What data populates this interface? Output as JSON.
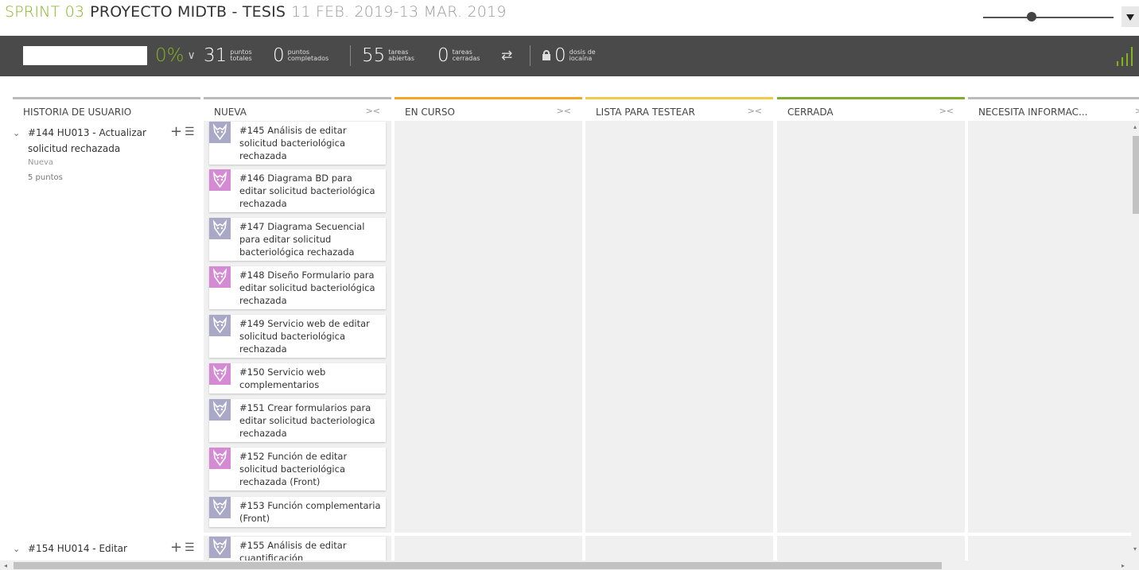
{
  "header": {
    "sprint": "SPRINT 03",
    "project": "PROYECTO MIDTB - TESIS",
    "dates": "11 FEB. 2019-13 MAR. 2019",
    "zoom_level": 0.37
  },
  "stats": {
    "search_value": "",
    "completion": "0%",
    "total_points": "31",
    "total_points_label": "puntos totales",
    "completed_points": "0",
    "completed_points_label": "puntos completados",
    "open_tasks": "55",
    "open_tasks_label": "tareas abiertas",
    "closed_tasks": "0",
    "closed_tasks_label": "tareas cerradas",
    "iocaine": "0",
    "iocaine_label": "dosis de iocaína"
  },
  "columns": {
    "story": "HISTORIA DE USUARIO",
    "new": "NUEVA",
    "in_progress": "EN CURSO",
    "ready_test": "LISTA PARA TESTEAR",
    "closed": "CERRADA",
    "needs_info": "NECESITA INFORMAC..."
  },
  "stories": [
    {
      "title": "#144 HU013 - Actualizar solicitud rechazada",
      "status": "Nueva",
      "points": "5 puntos"
    },
    {
      "title": "#154 HU014 - Editar"
    }
  ],
  "tasks": [
    {
      "text": "#145 Análisis de editar solicitud bacteriológica rechazada",
      "avatar": "grey"
    },
    {
      "text": "#146 Diagrama BD para editar solicitud bacteriológica rechazada",
      "avatar": "pink"
    },
    {
      "text": "#147 Diagrama Secuencial para editar solicitud bacteriológica rechazada",
      "avatar": "grey"
    },
    {
      "text": "#148 Diseño Formulario para editar solicitud bacteriológica rechazada",
      "avatar": "pink"
    },
    {
      "text": "#149 Servicio web de editar solicitud bacteriológica rechazada",
      "avatar": "grey"
    },
    {
      "text": "#150 Servicio web complementarios",
      "avatar": "pink"
    },
    {
      "text": "#151 Crear formularios para editar solicitud bacteriologica rechazada",
      "avatar": "grey"
    },
    {
      "text": "#152 Función de editar solicitud bacteriológica rechazada (Front)",
      "avatar": "pink"
    },
    {
      "text": "#153 Función complementaria (Front)",
      "avatar": "grey"
    },
    {
      "text": "#155 Análisis de editar cuantificación",
      "avatar": "grey"
    }
  ],
  "colors": {
    "accent_green": "#83b31f",
    "status_bar": "#4a4a4a",
    "in_progress": "#f5a623",
    "ready_test": "#f2c94c",
    "closed": "#7fae2f"
  }
}
